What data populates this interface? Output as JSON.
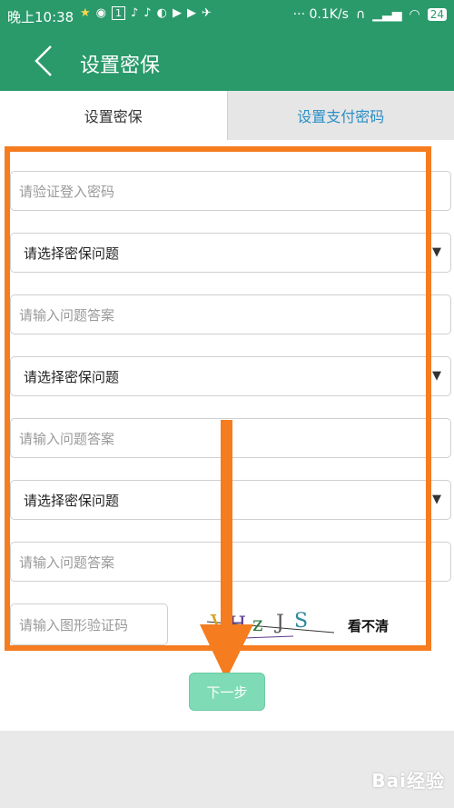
{
  "status_bar": {
    "time": "晚上10:38",
    "notification_badge": "1",
    "network_speed": "··· 0.1K/s",
    "battery": "24"
  },
  "header": {
    "title": "设置密保"
  },
  "tabs": [
    {
      "label": "设置密保",
      "active": true
    },
    {
      "label": "设置支付密码",
      "active": false
    }
  ],
  "form": {
    "password_placeholder": "请验证登入密码",
    "question1": "请选择密保问题",
    "answer1_placeholder": "请输入问题答案",
    "question2": "请选择密保问题",
    "answer2_placeholder": "请输入问题答案",
    "question3": "请选择密保问题",
    "answer3_placeholder": "请输入问题答案",
    "captcha_placeholder": "请输入图形验证码",
    "captcha_text": "VHzJS",
    "refresh_label": "看不清",
    "next_label": "下一步"
  },
  "watermark": "Bai经验",
  "colors": {
    "brand": "#2a9a6b",
    "link": "#2a8fc7",
    "annotation": "#f57c1f",
    "button": "#7fdbb6"
  }
}
